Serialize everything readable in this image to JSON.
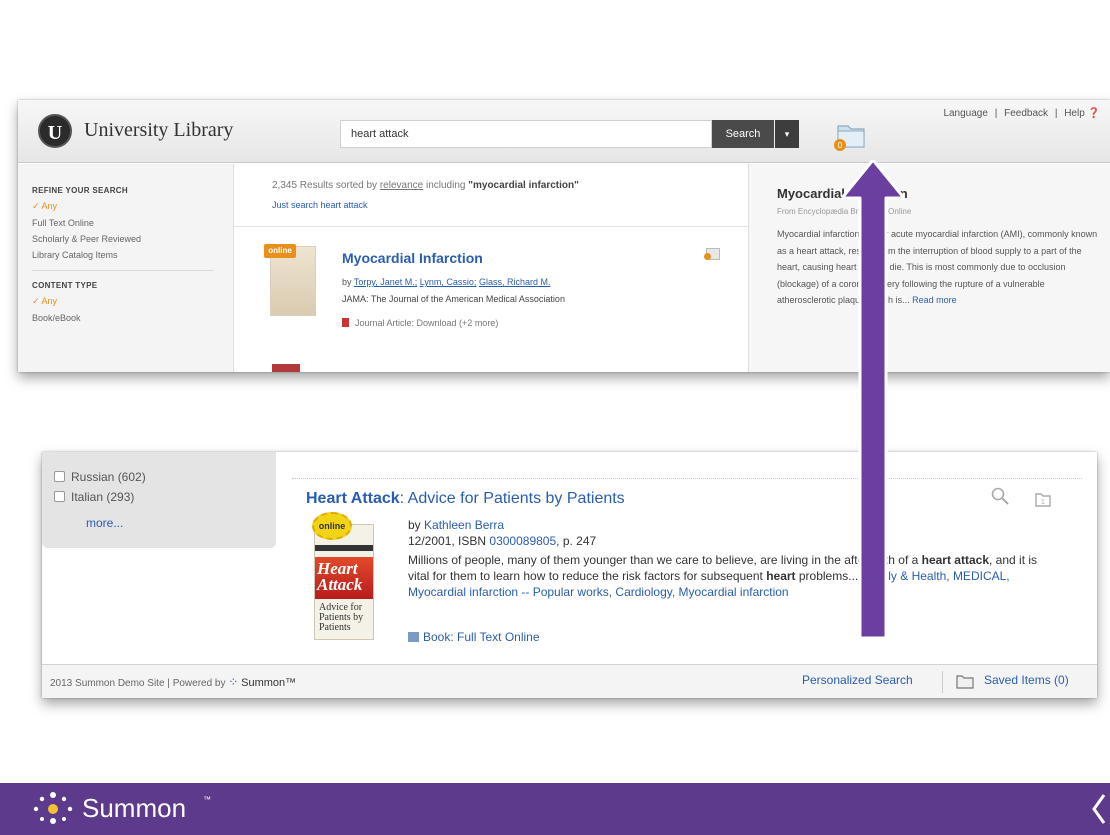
{
  "top": {
    "library_title": "University Library",
    "logo_letter": "U",
    "search_value": "heart attack",
    "search_button": "Search",
    "search_dropdown": "▾",
    "links": [
      "Language",
      "Feedback",
      "Help ❓"
    ],
    "link_separator": "|",
    "sidebar": {
      "refine_heading": "REFINE YOUR SEARCH",
      "refine_items": [
        "✓ Any",
        "Full Text Online",
        "Scholarly & Peer Reviewed",
        "Library Catalog Items"
      ],
      "content_heading": "CONTENT TYPE",
      "content_items": [
        "✓ Any",
        "Book/eBook"
      ]
    },
    "results": {
      "summary_prefix": "2,345 Results sorted by",
      "summary_sort": "relevance",
      "summary_middle": "including",
      "summary_term": "\"myocardial infarction\"",
      "just_search": "Just search heart attack",
      "result1": {
        "badge": "online",
        "title": "Myocardial Infarction",
        "by": "by",
        "authors": [
          "Torpy, Janet M.;",
          "Lynm, Cassio;",
          "Glass, Richard M."
        ],
        "journal": "JAMA: The Journal of the American Medical Association",
        "type": "Journal Article: Download (+2 more)"
      }
    },
    "info_panel": {
      "title": "Myocardial Infarction",
      "source": "From Encyclopædia Britannica Online",
      "body": "Myocardial infarction (MI) or acute myocardial infarction (AMI), commonly known as a heart attack, results from the interruption of blood supply to a part of the heart, causing heart cells to die. This is most commonly due to occlusion (blockage) of a coronary artery following the rupture of a vulnerable atherosclerotic plaque, which is...",
      "read_more": "Read more"
    }
  },
  "bottom": {
    "languages": [
      {
        "label": "Russian (602)"
      },
      {
        "label": "Italian (293)"
      }
    ],
    "more": "more...",
    "result": {
      "title_bold": "Heart Attack",
      "title_rest": ": Advice for Patients by Patients",
      "badge": "online",
      "cover_title": "Heart Attack",
      "cover_subtitle": "Advice for Patients by Patients",
      "by": "by",
      "author": "Kathleen Berra",
      "date_prefix": "12/2001, ISBN",
      "isbn": "0300089805",
      "date_suffix": ", p. 247",
      "desc_1": "Millions of people, many of them younger than we care to believe, are living in the aftermath of a",
      "desc_bold_1": "heart attack",
      "desc_2": ", and it is vital for them to learn how to reduce the risk factors for subsequent",
      "desc_bold_2": "heart",
      "desc_3": "problems...",
      "subjects": "Family & Health, MEDICAL, Myocardial infarction -- Popular works, Cardiology, Myocardial infarction",
      "type": "Book: Full Text Online"
    },
    "footer": {
      "site": "2013 Summon Demo Site",
      "separator": "|",
      "powered_by": "Powered by",
      "summon_mini": "Summon™",
      "personalized": "Personalized Search",
      "saved_items": "Saved Items (0)"
    }
  },
  "brand": {
    "name": "Summon",
    "tm": "™",
    "purple": "#5e3a8c",
    "accent_orange": "#e8901a",
    "link_blue": "#2a5db0"
  }
}
